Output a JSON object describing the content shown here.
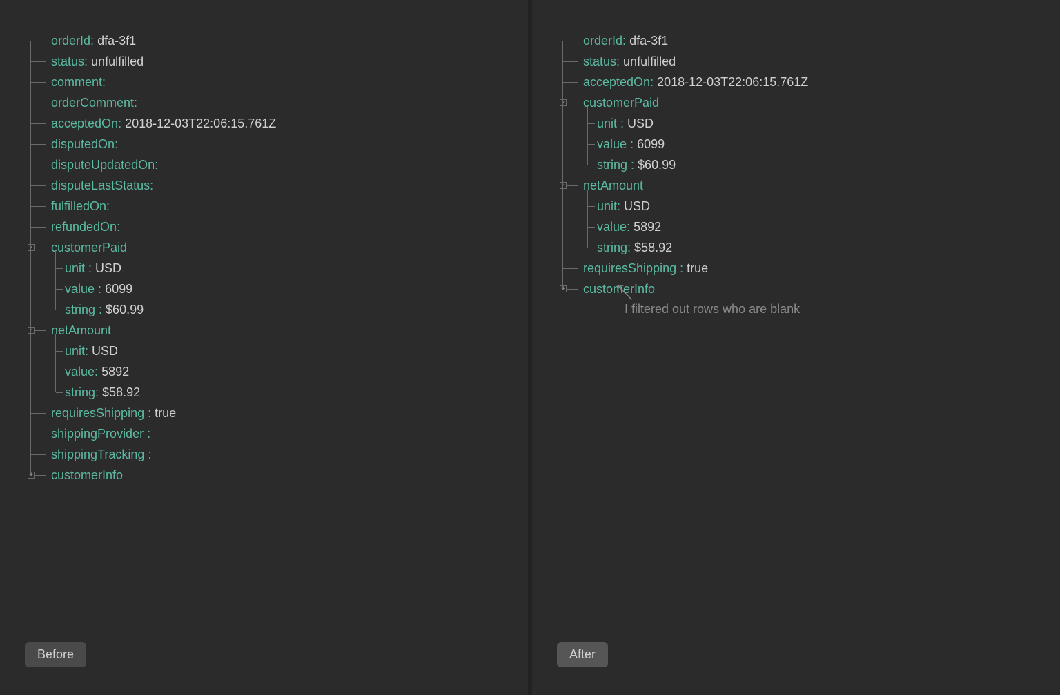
{
  "labels": {
    "before": "Before",
    "after": "After",
    "note": "I filtered out rows who are blank"
  },
  "toggles": {
    "minus": "-",
    "plus": "+"
  },
  "left": {
    "rows": [
      {
        "key": "orderId:",
        "val": "dfa-3f1",
        "depth": 0
      },
      {
        "key": "status:",
        "val": "unfulfilled",
        "depth": 0
      },
      {
        "key": "comment:",
        "val": "",
        "depth": 0
      },
      {
        "key": "orderComment:",
        "val": "",
        "depth": 0
      },
      {
        "key": "acceptedOn:",
        "val": "2018-12-03T22:06:15.761Z",
        "depth": 0
      },
      {
        "key": "disputedOn:",
        "val": "",
        "depth": 0
      },
      {
        "key": "disputeUpdatedOn:",
        "val": "",
        "depth": 0
      },
      {
        "key": "disputeLastStatus:",
        "val": "",
        "depth": 0
      },
      {
        "key": "fulfilledOn:",
        "val": "",
        "depth": 0
      },
      {
        "key": "refundedOn:",
        "val": "",
        "depth": 0
      },
      {
        "key": "customerPaid",
        "val": "",
        "depth": 0,
        "toggle": "minus"
      },
      {
        "key": "unit :",
        "val": "USD",
        "depth": 1
      },
      {
        "key": "value :",
        "val": "6099",
        "depth": 1
      },
      {
        "key": "string :",
        "val": "$60.99",
        "depth": 1
      },
      {
        "key": "netAmount",
        "val": "",
        "depth": 0,
        "toggle": "minus"
      },
      {
        "key": "unit:",
        "val": "USD",
        "depth": 1
      },
      {
        "key": "value:",
        "val": "5892",
        "depth": 1
      },
      {
        "key": "string:",
        "val": "$58.92",
        "depth": 1
      },
      {
        "key": "requiresShipping :",
        "val": "true",
        "depth": 0
      },
      {
        "key": "shippingProvider :",
        "val": "",
        "depth": 0
      },
      {
        "key": "shippingTracking :",
        "val": "",
        "depth": 0
      },
      {
        "key": "customerInfo",
        "val": "",
        "depth": 0,
        "toggle": "plus"
      }
    ]
  },
  "right": {
    "rows": [
      {
        "key": "orderId:",
        "val": "dfa-3f1",
        "depth": 0
      },
      {
        "key": "status:",
        "val": "unfulfilled",
        "depth": 0
      },
      {
        "key": "acceptedOn:",
        "val": "2018-12-03T22:06:15.761Z",
        "depth": 0
      },
      {
        "key": "customerPaid",
        "val": "",
        "depth": 0,
        "toggle": "minus"
      },
      {
        "key": "unit :",
        "val": "USD",
        "depth": 1
      },
      {
        "key": "value :",
        "val": "6099",
        "depth": 1
      },
      {
        "key": "string :",
        "val": "$60.99",
        "depth": 1
      },
      {
        "key": "netAmount",
        "val": "",
        "depth": 0,
        "toggle": "minus"
      },
      {
        "key": "unit:",
        "val": "USD",
        "depth": 1
      },
      {
        "key": "value:",
        "val": "5892",
        "depth": 1
      },
      {
        "key": "string:",
        "val": "$58.92",
        "depth": 1
      },
      {
        "key": "requiresShipping :",
        "val": "true",
        "depth": 0
      },
      {
        "key": "customerInfo",
        "val": "",
        "depth": 0,
        "toggle": "plus"
      }
    ]
  }
}
